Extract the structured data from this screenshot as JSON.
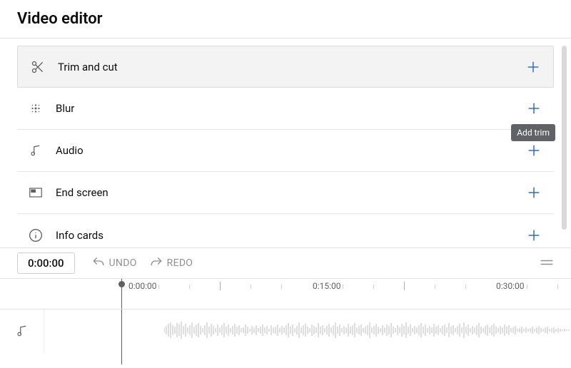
{
  "header": {
    "title": "Video editor"
  },
  "tools": [
    {
      "id": "trim-and-cut",
      "label": "Trim and cut",
      "icon": "scissors-icon",
      "selected": true
    },
    {
      "id": "blur",
      "label": "Blur",
      "icon": "blur-icon"
    },
    {
      "id": "audio",
      "label": "Audio",
      "icon": "music-note-icon"
    },
    {
      "id": "end-screen",
      "label": "End screen",
      "icon": "end-screen-icon"
    },
    {
      "id": "info-cards",
      "label": "Info cards",
      "icon": "info-icon"
    }
  ],
  "tooltip": {
    "add_trim": "Add trim"
  },
  "controls": {
    "current_time": "0:00:00",
    "undo_label": "UNDO",
    "redo_label": "REDO"
  },
  "timeline": {
    "marks": [
      "0:00:00",
      "0:15:00",
      "0:30:00"
    ],
    "playhead_time": "0:00:00",
    "tracks": [
      {
        "type": "audio"
      }
    ]
  }
}
